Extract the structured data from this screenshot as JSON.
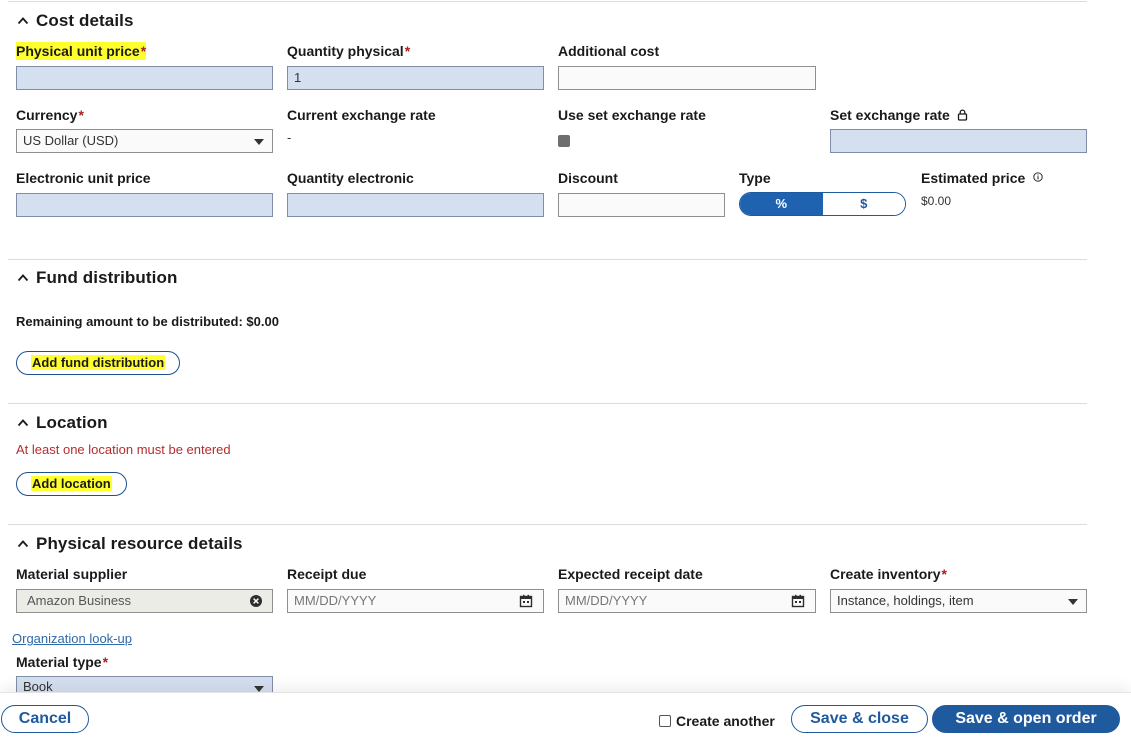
{
  "cost_details": {
    "title": "Cost details",
    "physical_unit_price": {
      "label": "Physical unit price",
      "req": "*",
      "value": ""
    },
    "quantity_physical": {
      "label": "Quantity physical",
      "req": "*",
      "value": "1"
    },
    "additional_cost": {
      "label": "Additional cost",
      "value": ""
    },
    "currency": {
      "label": "Currency",
      "req": "*",
      "value": "US Dollar (USD)"
    },
    "current_exchange_rate": {
      "label": "Current exchange rate",
      "value": "-"
    },
    "use_set_exchange_rate": {
      "label": "Use set exchange rate"
    },
    "set_exchange_rate": {
      "label": "Set exchange rate",
      "value": ""
    },
    "electronic_unit_price": {
      "label": "Electronic unit price",
      "value": ""
    },
    "quantity_electronic": {
      "label": "Quantity electronic",
      "value": ""
    },
    "discount": {
      "label": "Discount",
      "value": ""
    },
    "type": {
      "label": "Type",
      "options": [
        "%",
        "$"
      ],
      "selected": "%"
    },
    "estimated_price": {
      "label": "Estimated price",
      "value": "$0.00"
    }
  },
  "fund_distribution": {
    "title": "Fund distribution",
    "remaining": "Remaining amount to be distributed: $0.00",
    "add_button": "Add fund distribution"
  },
  "location": {
    "title": "Location",
    "warning": "At least one location must be entered",
    "add_button": "Add location"
  },
  "physical_resource": {
    "title": "Physical resource details",
    "material_supplier": {
      "label": "Material supplier",
      "value": "Amazon Business"
    },
    "receipt_due": {
      "label": "Receipt due",
      "placeholder": "MM/DD/YYYY"
    },
    "expected_receipt_date": {
      "label": "Expected receipt date",
      "placeholder": "MM/DD/YYYY"
    },
    "create_inventory": {
      "label": "Create inventory",
      "req": "*",
      "value": "Instance, holdings, item"
    },
    "org_lookup": "Organization look-up",
    "material_type": {
      "label": "Material type",
      "req": "*",
      "value": "Book"
    }
  },
  "footer": {
    "cancel": "Cancel",
    "create_another": "Create another",
    "save_close": "Save & close",
    "save_open": "Save & open order"
  },
  "colors": {
    "primary": "#1f5a9e",
    "highlight": "#ffff2e",
    "error": "#b52d2d",
    "input_blue": "#d4dff0"
  }
}
